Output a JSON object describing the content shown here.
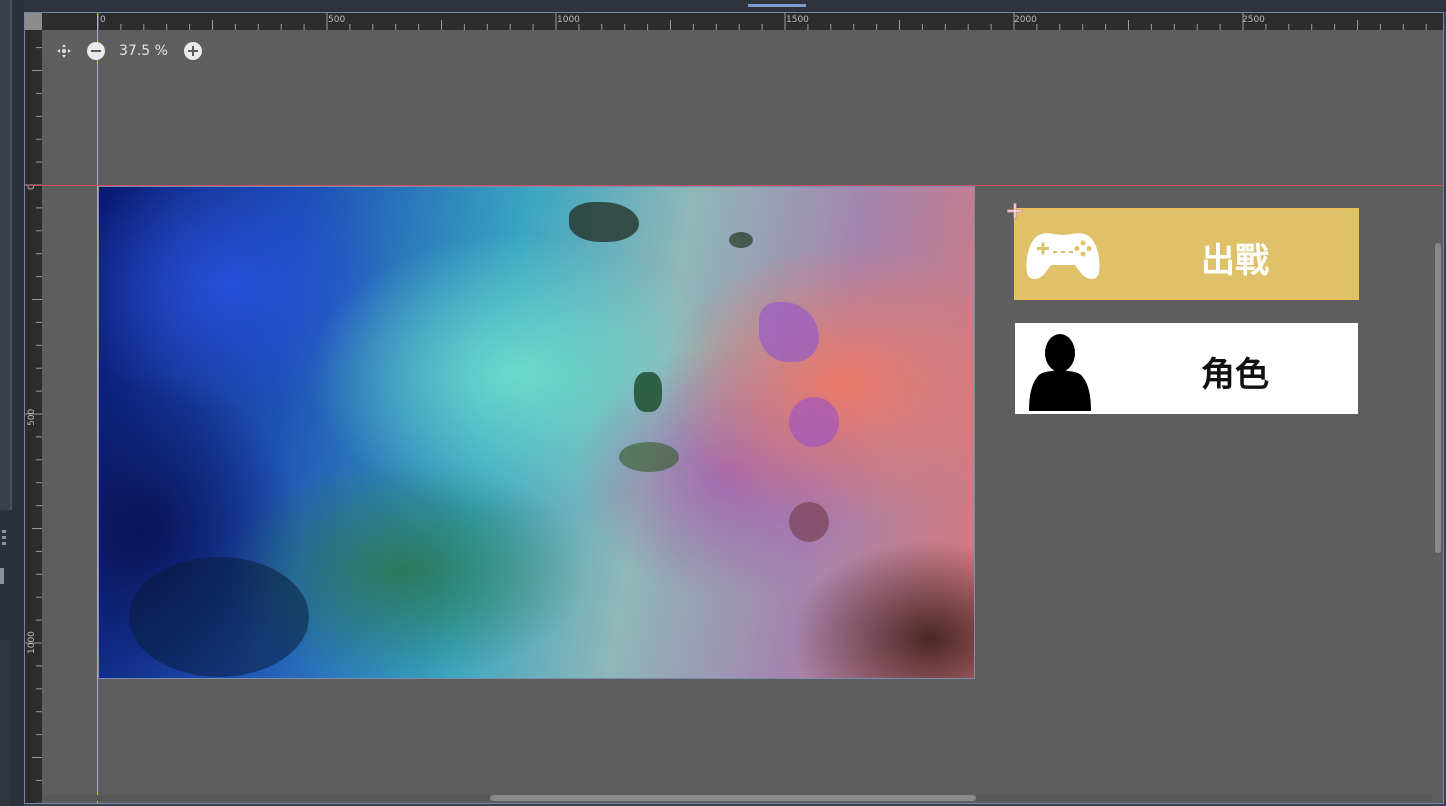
{
  "editor": {
    "zoom": {
      "value_label": "37.5 %"
    },
    "ruler": {
      "horizontal_ticks": [
        "0",
        "500",
        "1000",
        "1500",
        "2000",
        "2500"
      ],
      "vertical_ticks": [
        "0",
        "500",
        "1000"
      ]
    }
  },
  "scene": {
    "background": {
      "description_icon": "watercolor-texture"
    },
    "buttons": [
      {
        "label": "出戰",
        "icon": "gamepad-icon",
        "bg_color": "#dfc169",
        "text_color": "#ffffff"
      },
      {
        "label": "角色",
        "icon": "person-icon",
        "bg_color": "#ffffff",
        "text_color": "#111111"
      }
    ]
  },
  "colors": {
    "viewport_bg": "#5e5e5e",
    "guide_vertical": "#b8c23a",
    "guide_horizontal": "#cc4f60",
    "selection_border": "#6f86ad"
  }
}
